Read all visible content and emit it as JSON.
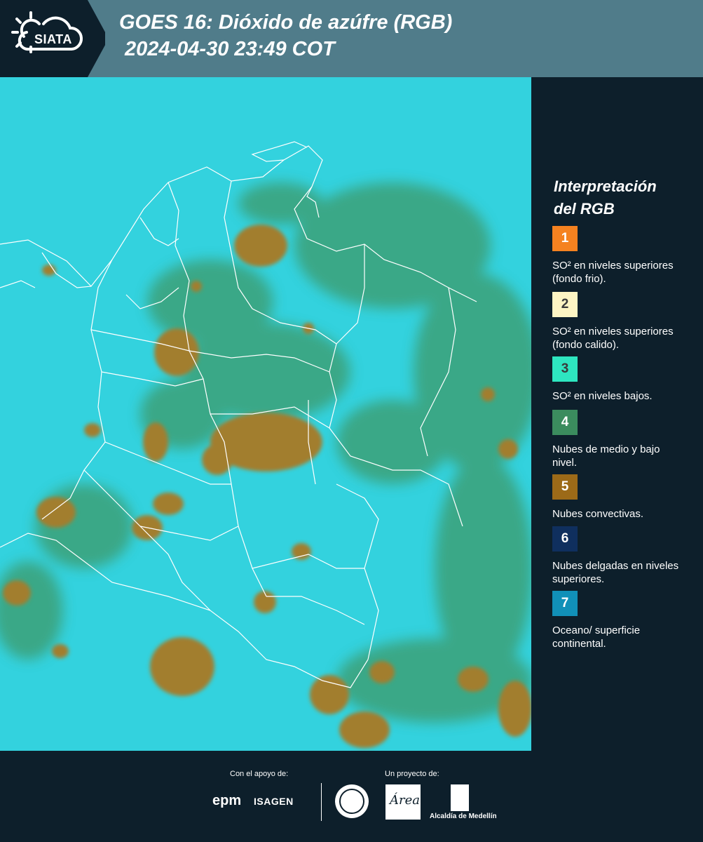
{
  "header": {
    "logo_text": "SIATA",
    "title_line1": "GOES 16: Dióxido de azúfre (RGB)",
    "title_line2": "2024-04-30 23:49 COT"
  },
  "legend": {
    "title_line1": "Interpretación",
    "title_line2": "del RGB",
    "items": [
      {
        "number": "1",
        "color": "#f58220",
        "text": "SO² en niveles superiores (fondo frio)."
      },
      {
        "number": "2",
        "color": "#fdf5c4",
        "text": "SO² en niveles superiores (fondo calido)."
      },
      {
        "number": "3",
        "color": "#2ee6c0",
        "text": "SO² en niveles bajos."
      },
      {
        "number": "4",
        "color": "#3b8c5e",
        "text": "Nubes de medio y bajo nivel."
      },
      {
        "number": "5",
        "color": "#9c6a18",
        "text": "Nubes convectivas."
      },
      {
        "number": "6",
        "color": "#0f2f5e",
        "text": "Nubes delgadas en niveles superiores."
      },
      {
        "number": "7",
        "color": "#1190b8",
        "text": "Oceano/ superficie continental."
      }
    ]
  },
  "footer": {
    "support_label": "Con el apoyo de:",
    "project_label": "Un proyecto de:",
    "sponsor1": "epm",
    "sponsor2": "ISAGEN",
    "partner_area": "Área",
    "partner_alcaldia": "Alcaldía de Medellín"
  }
}
